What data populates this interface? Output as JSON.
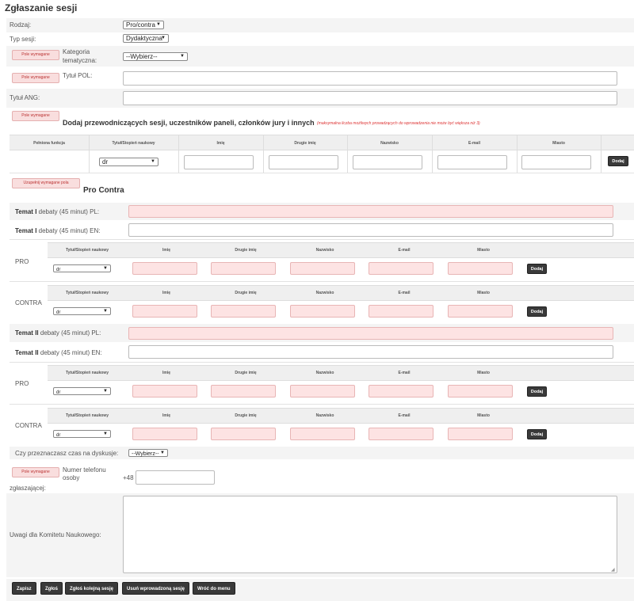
{
  "page_title": "Zgłaszanie sesji",
  "required_badge": "Pole wymagane",
  "fill_required_badge": "Uzupełnij wymagane pola",
  "form": {
    "rodzaj": {
      "label": "Rodzaj:",
      "value": "Pro/contra"
    },
    "typ": {
      "label": "Typ sesji:",
      "value": "Dydaktyczna"
    },
    "kategoria": {
      "label_line1": "Kategoria",
      "label_line2": "tematyczna:",
      "value": "--Wybierz--"
    },
    "tytul_pol": {
      "label": "Tytuł POL:"
    },
    "tytul_ang": {
      "label": "Tytuł ANG:"
    }
  },
  "chairs": {
    "heading": "Dodaj przewodniczących sesji, uczestników paneli, członków jury i innych",
    "note": "(maksymalna liczba możliwych prowadzących do wprowadzenia nie może być większa niż 3)",
    "columns": [
      "Pełniona funkcja",
      "Tytuł/Stopień naukowy",
      "Imię",
      "Drugie imię",
      "Nazwisko",
      "E-mail",
      "Miasto"
    ],
    "title_value": "dr",
    "add_label": "Dodaj"
  },
  "procontra": {
    "heading": "Pro Contra",
    "temat1_pl": {
      "bold": "Temat I",
      "rest": " debaty (45 minut) PL:"
    },
    "temat1_en": {
      "bold": "Temat I",
      "rest": " debaty (45 minut) EN:"
    },
    "temat2_pl": {
      "bold": "Temat II",
      "rest": " debaty (45 minut) PL:"
    },
    "temat2_en": {
      "bold": "Temat II",
      "rest": " debaty (45 minut) EN:"
    },
    "pro_label": "PRO",
    "contra_label": "CONTRA",
    "columns": [
      "Tytuł/Stopień naukowy",
      "Imię",
      "Drugie imię",
      "Nazwisko",
      "E-mail",
      "Miasto"
    ],
    "title_value": "dr",
    "add_label": "Dodaj"
  },
  "discussion": {
    "label": "Czy przeznaczasz czas na dyskusje:",
    "value": "--Wybierz--"
  },
  "phone": {
    "label_line1": "Numer telefonu",
    "label_line2": "osoby",
    "label_line3": "zgłaszającej:",
    "prefix": "+48"
  },
  "remarks": {
    "label": "Uwagi dla Komitetu Naukowego:"
  },
  "buttons": {
    "save": "Zapisz",
    "submit": "Zgłoś",
    "submit_next": "Zgłoś kolejną sesję",
    "delete": "Usuń wprowadzoną sesję",
    "menu": "Wróć do menu"
  }
}
